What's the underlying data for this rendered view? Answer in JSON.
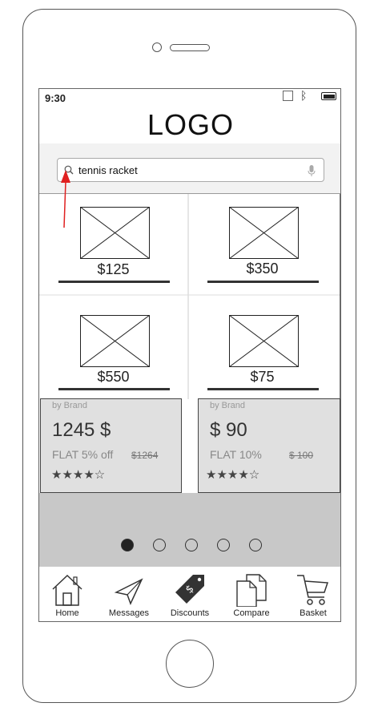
{
  "status_bar": {
    "time": "9:30"
  },
  "header": {
    "logo": "LOGO"
  },
  "search": {
    "value": "tennis racket"
  },
  "products": [
    {
      "price": "$125"
    },
    {
      "price": "$350"
    },
    {
      "price": "$550"
    },
    {
      "price": "$75"
    }
  ],
  "cards": [
    {
      "brand": "by Brand",
      "price": "1245 $",
      "discount": "FLAT 5% off",
      "old_price": "$1264",
      "rating": 4
    },
    {
      "brand": "by Brand",
      "price": "$ 90",
      "discount": "FLAT 10%",
      "old_price": "$ 100",
      "rating": 4
    }
  ],
  "carousel": {
    "pages": 5,
    "active": 1
  },
  "nav": [
    {
      "label": "Home",
      "icon": "home-icon"
    },
    {
      "label": "Messages",
      "icon": "send-icon"
    },
    {
      "label": "Discounts",
      "icon": "price-tag-icon"
    },
    {
      "label": "Compare",
      "icon": "documents-icon"
    },
    {
      "label": "Basket",
      "icon": "cart-icon"
    }
  ],
  "colors": {
    "accent_arrow": "#e02020",
    "carousel_bg": "#c8c8c8",
    "card_bg": "#e0e0e0"
  }
}
